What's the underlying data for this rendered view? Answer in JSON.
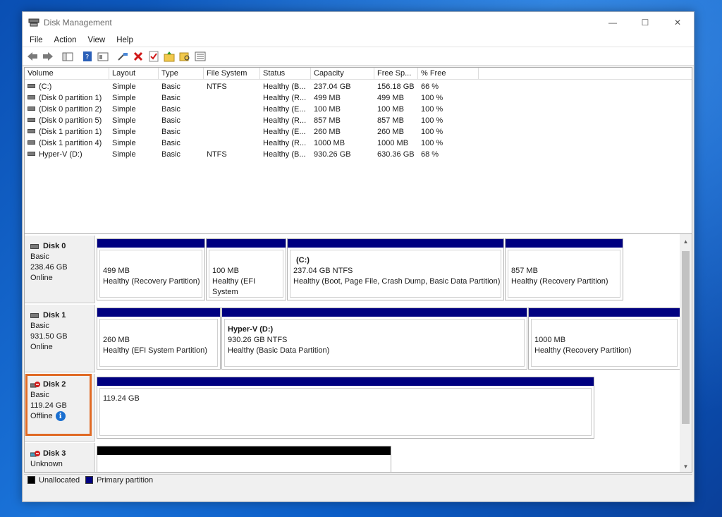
{
  "window": {
    "title": "Disk Management",
    "controls": {
      "minimize": "—",
      "maximize": "☐",
      "close": "✕"
    }
  },
  "menu": [
    "File",
    "Action",
    "View",
    "Help"
  ],
  "toolbar": [
    "back-icon",
    "forward-icon",
    "console-tree-icon",
    "help-icon",
    "properties-icon",
    "connect-icon",
    "delete-icon",
    "checklist-icon",
    "folder-up-icon",
    "folder-search-icon",
    "list-view-icon"
  ],
  "volume_list": {
    "columns": [
      "Volume",
      "Layout",
      "Type",
      "File System",
      "Status",
      "Capacity",
      "Free Sp...",
      "% Free"
    ],
    "rows": [
      {
        "volume": "(C:)",
        "layout": "Simple",
        "type": "Basic",
        "fs": "NTFS",
        "status": "Healthy (B...",
        "capacity": "237.04 GB",
        "free": "156.18 GB",
        "pct": "66 %"
      },
      {
        "volume": "(Disk 0 partition 1)",
        "layout": "Simple",
        "type": "Basic",
        "fs": "",
        "status": "Healthy (R...",
        "capacity": "499 MB",
        "free": "499 MB",
        "pct": "100 %"
      },
      {
        "volume": "(Disk 0 partition 2)",
        "layout": "Simple",
        "type": "Basic",
        "fs": "",
        "status": "Healthy (E...",
        "capacity": "100 MB",
        "free": "100 MB",
        "pct": "100 %"
      },
      {
        "volume": "(Disk 0 partition 5)",
        "layout": "Simple",
        "type": "Basic",
        "fs": "",
        "status": "Healthy (R...",
        "capacity": "857 MB",
        "free": "857 MB",
        "pct": "100 %"
      },
      {
        "volume": "(Disk 1 partition 1)",
        "layout": "Simple",
        "type": "Basic",
        "fs": "",
        "status": "Healthy (E...",
        "capacity": "260 MB",
        "free": "260 MB",
        "pct": "100 %"
      },
      {
        "volume": "(Disk 1 partition 4)",
        "layout": "Simple",
        "type": "Basic",
        "fs": "",
        "status": "Healthy (R...",
        "capacity": "1000 MB",
        "free": "1000 MB",
        "pct": "100 %"
      },
      {
        "volume": "Hyper-V (D:)",
        "layout": "Simple",
        "type": "Basic",
        "fs": "NTFS",
        "status": "Healthy (B...",
        "capacity": "930.26 GB",
        "free": "630.36 GB",
        "pct": "68 %"
      }
    ]
  },
  "disks": [
    {
      "name": "Disk 0",
      "type": "Basic",
      "size": "238.46 GB",
      "status": "Online",
      "partitions": [
        {
          "title": "",
          "size": "499 MB",
          "desc": "Healthy (Recovery Partition)"
        },
        {
          "title": "",
          "size": "100 MB",
          "desc": "Healthy (EFI System"
        },
        {
          "title": "(C:)",
          "size": "237.04 GB NTFS",
          "desc": "Healthy (Boot, Page File, Crash Dump, Basic Data Partition)"
        },
        {
          "title": "",
          "size": "857 MB",
          "desc": "Healthy (Recovery Partition)"
        }
      ]
    },
    {
      "name": "Disk 1",
      "type": "Basic",
      "size": "931.50 GB",
      "status": "Online",
      "partitions": [
        {
          "title": "",
          "size": "260 MB",
          "desc": "Healthy (EFI System Partition)"
        },
        {
          "title": "Hyper-V  (D:)",
          "size": "930.26 GB NTFS",
          "desc": "Healthy (Basic Data Partition)"
        },
        {
          "title": "",
          "size": "1000 MB",
          "desc": "Healthy (Recovery Partition)"
        }
      ]
    },
    {
      "name": "Disk 2",
      "type": "Basic",
      "size": "119.24 GB",
      "status": "Offline",
      "partitions": [
        {
          "title": "",
          "size": "119.24 GB",
          "desc": ""
        }
      ]
    },
    {
      "name": "Disk 3",
      "type": "Unknown",
      "size": "",
      "status": "",
      "partitions": [
        {
          "title": "",
          "size": "",
          "desc": ""
        }
      ]
    }
  ],
  "legend": [
    "Unallocated",
    "Primary partition"
  ],
  "colors": {
    "unallocated": "#000000",
    "primary": "#000080",
    "highlight": "#e06a25"
  }
}
